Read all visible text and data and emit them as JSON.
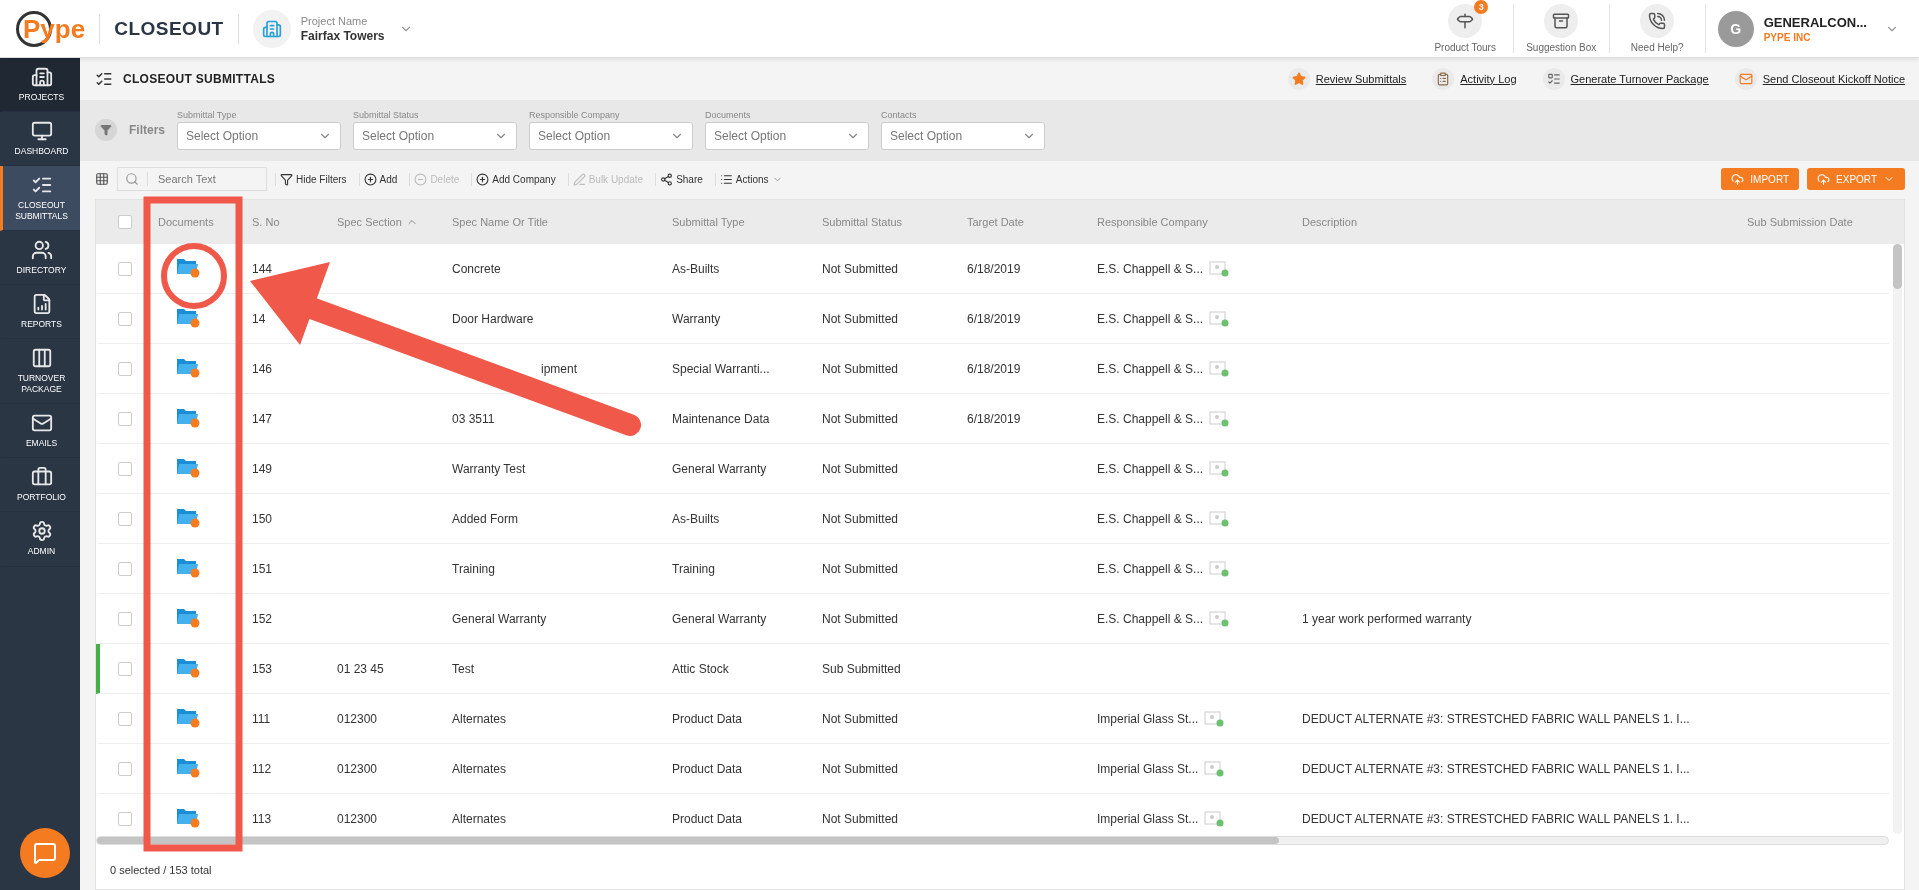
{
  "header": {
    "logo": "Pype",
    "app": "CLOSEOUT",
    "project_label": "Project Name",
    "project": "Fairfax Towers",
    "buttons": [
      {
        "kind": "tours",
        "label": "Product Tours",
        "badge": "3"
      },
      {
        "kind": "suggestion",
        "label": "Suggestion Box"
      },
      {
        "kind": "help",
        "label": "Need Help?"
      }
    ],
    "user": {
      "initial": "G",
      "name": "GENERALCON...",
      "company": "PYPE INC"
    }
  },
  "sidebar": {
    "items": [
      {
        "kind": "projects",
        "label": "PROJECTS",
        "selected": false
      },
      {
        "kind": "dashboard",
        "label": "DASHBOARD",
        "selected": false
      },
      {
        "kind": "closeout",
        "label": "CLOSEOUT SUBMITTALS",
        "selected": true
      },
      {
        "kind": "directory",
        "label": "DIRECTORY",
        "selected": false
      },
      {
        "kind": "reports",
        "label": "REPORTS",
        "selected": false
      },
      {
        "kind": "turnover",
        "label": "TURNOVER PACKAGE",
        "selected": false
      },
      {
        "kind": "emails",
        "label": "EMAILS",
        "selected": false
      },
      {
        "kind": "portfolio",
        "label": "PORTFOLIO",
        "selected": false
      },
      {
        "kind": "admin",
        "label": "ADMIN",
        "selected": false
      }
    ]
  },
  "page": {
    "title": "CLOSEOUT SUBMITTALS",
    "links": [
      {
        "kind": "star",
        "label": "Review Submittals"
      },
      {
        "kind": "log",
        "label": "Activity Log"
      },
      {
        "kind": "list",
        "label": "Generate Turnover Package"
      },
      {
        "kind": "mail",
        "label": "Send Closeout Kickoff Notice"
      }
    ]
  },
  "filters": {
    "label": "Filters",
    "items": [
      {
        "label": "Submittal Type",
        "placeholder": "Select Option"
      },
      {
        "label": "Submittal Status",
        "placeholder": "Select Option"
      },
      {
        "label": "Responsible Company",
        "placeholder": "Select Option"
      },
      {
        "label": "Documents",
        "placeholder": "Select Option"
      },
      {
        "label": "Contacts",
        "placeholder": "Select Option"
      }
    ]
  },
  "toolbar": {
    "search": {
      "placeholder": "Search Text"
    },
    "actions": [
      {
        "kind": "filter",
        "label": "Hide Filters",
        "disabled": false
      },
      {
        "kind": "add",
        "label": "Add",
        "disabled": false
      },
      {
        "kind": "delete",
        "label": "Delete",
        "disabled": true
      },
      {
        "kind": "add",
        "label": "Add Company",
        "disabled": false
      },
      {
        "kind": "edit",
        "label": "Bulk Update",
        "disabled": true
      },
      {
        "kind": "share",
        "label": "Share",
        "disabled": false
      },
      {
        "kind": "menu",
        "label": "Actions",
        "disabled": false
      }
    ],
    "import": "IMPORT",
    "export": "EXPORT"
  },
  "table": {
    "select_all_checked": false,
    "columns": [
      "Documents",
      "S. No",
      "Spec Section",
      "Spec Name Or Title",
      "Submittal Type",
      "Submittal Status",
      "Target Date",
      "Responsible Company",
      "Description",
      "Sub Submission Date"
    ],
    "rows": [
      {
        "checked": false,
        "marked": false,
        "s_no": "144",
        "spec_section": "",
        "spec_name": "Concrete",
        "offset": false,
        "type": "As-Builts",
        "status": "Not Submitted",
        "target_date": "6/18/2019",
        "company": "E.S. Chappell & S...",
        "description": ""
      },
      {
        "checked": false,
        "marked": false,
        "s_no": "14",
        "spec_section": "",
        "spec_name": "Door Hardware",
        "offset": false,
        "type": "Warranty",
        "status": "Not Submitted",
        "target_date": "6/18/2019",
        "company": "E.S. Chappell & S...",
        "description": ""
      },
      {
        "checked": false,
        "marked": false,
        "s_no": "146",
        "spec_section": "",
        "spec_name": "ipment",
        "offset": true,
        "type": "Special Warranti...",
        "status": "Not Submitted",
        "target_date": "6/18/2019",
        "company": "E.S. Chappell & S...",
        "description": ""
      },
      {
        "checked": false,
        "marked": false,
        "s_no": "147",
        "spec_section": "",
        "spec_name": "03 3511",
        "offset": false,
        "type": "Maintenance Data",
        "status": "Not Submitted",
        "target_date": "6/18/2019",
        "company": "E.S. Chappell & S...",
        "description": ""
      },
      {
        "checked": false,
        "marked": false,
        "s_no": "149",
        "spec_section": "",
        "spec_name": "Warranty Test",
        "offset": false,
        "type": "General Warranty",
        "status": "Not Submitted",
        "target_date": "",
        "company": "E.S. Chappell & S...",
        "description": ""
      },
      {
        "checked": false,
        "marked": false,
        "s_no": "150",
        "spec_section": "",
        "spec_name": "Added Form",
        "offset": false,
        "type": "As-Builts",
        "status": "Not Submitted",
        "target_date": "",
        "company": "E.S. Chappell & S...",
        "description": ""
      },
      {
        "checked": false,
        "marked": false,
        "s_no": "151",
        "spec_section": "",
        "spec_name": "Training",
        "offset": false,
        "type": "Training",
        "status": "Not Submitted",
        "target_date": "",
        "company": "E.S. Chappell & S...",
        "description": ""
      },
      {
        "checked": false,
        "marked": false,
        "s_no": "152",
        "spec_section": "",
        "spec_name": "General Warranty",
        "offset": false,
        "type": "General Warranty",
        "status": "Not Submitted",
        "target_date": "",
        "company": "E.S. Chappell & S...",
        "description": "1 year work performed warranty"
      },
      {
        "checked": false,
        "marked": true,
        "s_no": "153",
        "spec_section": "01 23 45",
        "spec_name": "Test",
        "offset": false,
        "type": "Attic Stock",
        "status": "Sub Submitted",
        "target_date": "",
        "company": "",
        "description": ""
      },
      {
        "checked": false,
        "marked": false,
        "s_no": "111",
        "spec_section": "012300",
        "spec_name": "Alternates",
        "offset": false,
        "type": "Product Data",
        "status": "Not Submitted",
        "target_date": "",
        "company": "Imperial Glass St...",
        "description": "DEDUCT ALTERNATE #3: STRESTCHED FABRIC WALL PANELS 1. I..."
      },
      {
        "checked": false,
        "marked": false,
        "s_no": "112",
        "spec_section": "012300",
        "spec_name": "Alternates",
        "offset": false,
        "type": "Product Data",
        "status": "Not Submitted",
        "target_date": "",
        "company": "Imperial Glass St...",
        "description": "DEDUCT ALTERNATE #3: STRESTCHED FABRIC WALL PANELS 1. I..."
      },
      {
        "checked": false,
        "marked": false,
        "s_no": "113",
        "spec_section": "012300",
        "spec_name": "Alternates",
        "offset": false,
        "type": "Product Data",
        "status": "Not Submitted",
        "target_date": "",
        "company": "Imperial Glass St...",
        "description": "DEDUCT ALTERNATE #3: STRESTCHED FABRIC WALL PANELS 1. I..."
      }
    ]
  },
  "footer": {
    "summary": "0 selected / 153 total"
  }
}
